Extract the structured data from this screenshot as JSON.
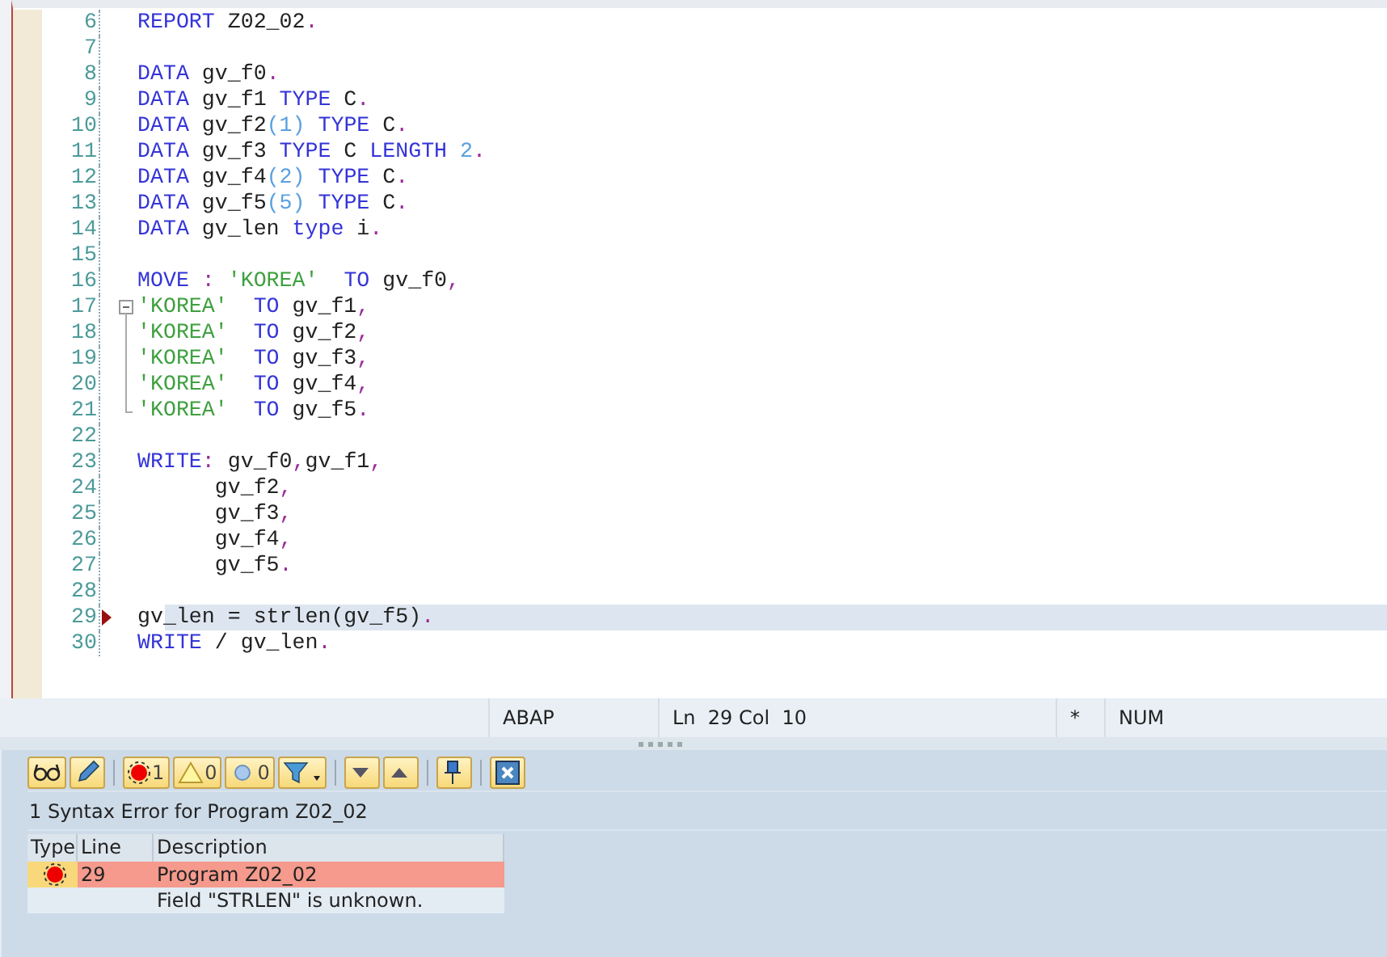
{
  "editor": {
    "lines": [
      {
        "number": "6",
        "kind": "code",
        "current": false,
        "error": false,
        "tokens": [
          {
            "kind": "keyword",
            "text": "REPORT"
          },
          {
            "kind": "plain",
            "text": " Z02_02"
          },
          {
            "kind": "punct",
            "text": "."
          }
        ]
      },
      {
        "number": "7",
        "kind": "code",
        "current": false,
        "error": false
      },
      {
        "number": "8",
        "kind": "code",
        "current": false,
        "error": false,
        "tokens": [
          {
            "kind": "keyword",
            "text": "DATA"
          },
          {
            "kind": "plain",
            "text": " gv_f0"
          },
          {
            "kind": "punct",
            "text": "."
          }
        ]
      },
      {
        "number": "9",
        "kind": "code",
        "current": false,
        "error": false,
        "tokens": [
          {
            "kind": "keyword",
            "text": "DATA"
          },
          {
            "kind": "plain",
            "text": " gv_f1 "
          },
          {
            "kind": "keyword",
            "text": "TYPE"
          },
          {
            "kind": "plain",
            "text": " C"
          },
          {
            "kind": "punct",
            "text": "."
          }
        ]
      },
      {
        "number": "10",
        "kind": "code",
        "current": false,
        "error": false,
        "tokens": [
          {
            "kind": "keyword",
            "text": "DATA"
          },
          {
            "kind": "plain",
            "text": " gv_f2"
          },
          {
            "kind": "number",
            "text": "(1)"
          },
          {
            "kind": "keyword",
            "text": " TYPE"
          },
          {
            "kind": "plain",
            "text": " C"
          },
          {
            "kind": "punct",
            "text": "."
          }
        ]
      },
      {
        "number": "11",
        "kind": "code",
        "current": false,
        "error": false,
        "tokens": [
          {
            "kind": "keyword",
            "text": "DATA"
          },
          {
            "kind": "plain",
            "text": " gv_f3 "
          },
          {
            "kind": "keyword",
            "text": "TYPE"
          },
          {
            "kind": "plain",
            "text": " C "
          },
          {
            "kind": "keyword",
            "text": "LENGTH"
          },
          {
            "kind": "number",
            "text": " 2"
          },
          {
            "kind": "punct",
            "text": "."
          }
        ]
      },
      {
        "number": "12",
        "kind": "code",
        "current": false,
        "error": false,
        "tokens": [
          {
            "kind": "keyword",
            "text": "DATA"
          },
          {
            "kind": "plain",
            "text": " gv_f4"
          },
          {
            "kind": "number",
            "text": "(2)"
          },
          {
            "kind": "keyword",
            "text": " TYPE"
          },
          {
            "kind": "plain",
            "text": " C"
          },
          {
            "kind": "punct",
            "text": "."
          }
        ]
      },
      {
        "number": "13",
        "kind": "code",
        "current": false,
        "error": false,
        "tokens": [
          {
            "kind": "keyword",
            "text": "DATA"
          },
          {
            "kind": "plain",
            "text": " gv_f5"
          },
          {
            "kind": "number",
            "text": "(5)"
          },
          {
            "kind": "keyword",
            "text": " TYPE"
          },
          {
            "kind": "plain",
            "text": " C"
          },
          {
            "kind": "punct",
            "text": "."
          }
        ]
      },
      {
        "number": "14",
        "kind": "code",
        "current": false,
        "error": false,
        "tokens": [
          {
            "kind": "keyword",
            "text": "DATA"
          },
          {
            "kind": "plain",
            "text": " gv_len "
          },
          {
            "kind": "keyword",
            "text": "type"
          },
          {
            "kind": "plain",
            "text": " i"
          },
          {
            "kind": "punct",
            "text": "."
          }
        ]
      },
      {
        "number": "15",
        "kind": "code",
        "current": false,
        "error": false
      },
      {
        "number": "16",
        "kind": "code",
        "current": false,
        "error": false,
        "tokens": [
          {
            "kind": "keyword",
            "text": "MOVE"
          },
          {
            "kind": "punct",
            "text": " :"
          },
          {
            "kind": "string",
            "text": " 'KOREA'"
          },
          {
            "kind": "keyword",
            "text": "  TO"
          },
          {
            "kind": "plain",
            "text": " gv_f0"
          },
          {
            "kind": "punct",
            "text": ","
          }
        ]
      },
      {
        "number": "17",
        "kind": "fold_start",
        "current": false,
        "error": false,
        "tokens": [
          {
            "kind": "string",
            "text": "'KOREA'"
          },
          {
            "kind": "keyword",
            "text": "  TO"
          },
          {
            "kind": "plain",
            "text": " gv_f1"
          },
          {
            "kind": "punct",
            "text": ","
          }
        ]
      },
      {
        "number": "18",
        "kind": "fold_body",
        "current": false,
        "error": false,
        "tokens": [
          {
            "kind": "string",
            "text": "'KOREA'"
          },
          {
            "kind": "keyword",
            "text": "  TO"
          },
          {
            "kind": "plain",
            "text": " gv_f2"
          },
          {
            "kind": "punct",
            "text": ","
          }
        ]
      },
      {
        "number": "19",
        "kind": "fold_body",
        "current": false,
        "error": false,
        "tokens": [
          {
            "kind": "string",
            "text": "'KOREA'"
          },
          {
            "kind": "keyword",
            "text": "  TO"
          },
          {
            "kind": "plain",
            "text": " gv_f3"
          },
          {
            "kind": "punct",
            "text": ","
          }
        ]
      },
      {
        "number": "20",
        "kind": "fold_body",
        "current": false,
        "error": false,
        "tokens": [
          {
            "kind": "string",
            "text": "'KOREA'"
          },
          {
            "kind": "keyword",
            "text": "  TO"
          },
          {
            "kind": "plain",
            "text": " gv_f4"
          },
          {
            "kind": "punct",
            "text": ","
          }
        ]
      },
      {
        "number": "21",
        "kind": "fold_end",
        "current": false,
        "error": false,
        "tokens": [
          {
            "kind": "string",
            "text": "'KOREA'"
          },
          {
            "kind": "keyword",
            "text": "  TO"
          },
          {
            "kind": "plain",
            "text": " gv_f5"
          },
          {
            "kind": "punct",
            "text": "."
          }
        ]
      },
      {
        "number": "22",
        "kind": "code",
        "current": false,
        "error": false
      },
      {
        "number": "23",
        "kind": "code",
        "current": false,
        "error": false,
        "tokens": [
          {
            "kind": "keyword",
            "text": "WRITE"
          },
          {
            "kind": "punct",
            "text": ":"
          },
          {
            "kind": "plain",
            "text": " gv_f0"
          },
          {
            "kind": "punct",
            "text": ","
          },
          {
            "kind": "plain",
            "text": "gv_f1"
          },
          {
            "kind": "punct",
            "text": ","
          }
        ]
      },
      {
        "number": "24",
        "kind": "code",
        "current": false,
        "error": false,
        "tokens": [
          {
            "kind": "plain",
            "text": "      gv_f2"
          },
          {
            "kind": "punct",
            "text": ","
          }
        ]
      },
      {
        "number": "25",
        "kind": "code",
        "current": false,
        "error": false,
        "tokens": [
          {
            "kind": "plain",
            "text": "      gv_f3"
          },
          {
            "kind": "punct",
            "text": ","
          }
        ]
      },
      {
        "number": "26",
        "kind": "code",
        "current": false,
        "error": false,
        "tokens": [
          {
            "kind": "plain",
            "text": "      gv_f4"
          },
          {
            "kind": "punct",
            "text": ","
          }
        ]
      },
      {
        "number": "27",
        "kind": "code",
        "current": false,
        "error": false,
        "tokens": [
          {
            "kind": "plain",
            "text": "      gv_f5"
          },
          {
            "kind": "punct",
            "text": "."
          }
        ]
      },
      {
        "number": "28",
        "kind": "code",
        "current": false,
        "error": false
      },
      {
        "number": "29",
        "kind": "code",
        "current": true,
        "error": true,
        "tokens": [
          {
            "kind": "plain",
            "text": "gv_len = strlen(gv_f5)"
          },
          {
            "kind": "punct",
            "text": "."
          }
        ]
      },
      {
        "number": "30",
        "kind": "code",
        "current": false,
        "error": false,
        "tokens": [
          {
            "kind": "keyword",
            "text": "WRITE"
          },
          {
            "kind": "plain",
            "text": " / gv_len"
          },
          {
            "kind": "punct",
            "text": "."
          }
        ]
      }
    ]
  },
  "status_bar": [
    "ABAP",
    "Ln  29 Col  10",
    "*",
    "NUM"
  ],
  "toolbar": [
    {
      "kind": "display"
    },
    {
      "kind": "edit"
    },
    {
      "kind": "separator"
    },
    {
      "kind": "errors",
      "count": "1"
    },
    {
      "kind": "warnings",
      "count": "0"
    },
    {
      "kind": "infos",
      "count": "0"
    },
    {
      "kind": "filter"
    },
    {
      "kind": "separator"
    },
    {
      "kind": "down"
    },
    {
      "kind": "up"
    },
    {
      "kind": "separator"
    },
    {
      "kind": "pin"
    },
    {
      "kind": "separator"
    },
    {
      "kind": "close"
    }
  ],
  "messages": {
    "title": "1 Syntax Error for Program Z02_02",
    "columns": [
      "Type",
      "Line",
      "Description"
    ],
    "rows": [
      {
        "kind": "error",
        "line": "29",
        "description": "Program Z02_02",
        "selected": true
      },
      {
        "kind": "detail",
        "description": "Field \"STRLEN\" is unknown.",
        "selected": false
      }
    ]
  }
}
